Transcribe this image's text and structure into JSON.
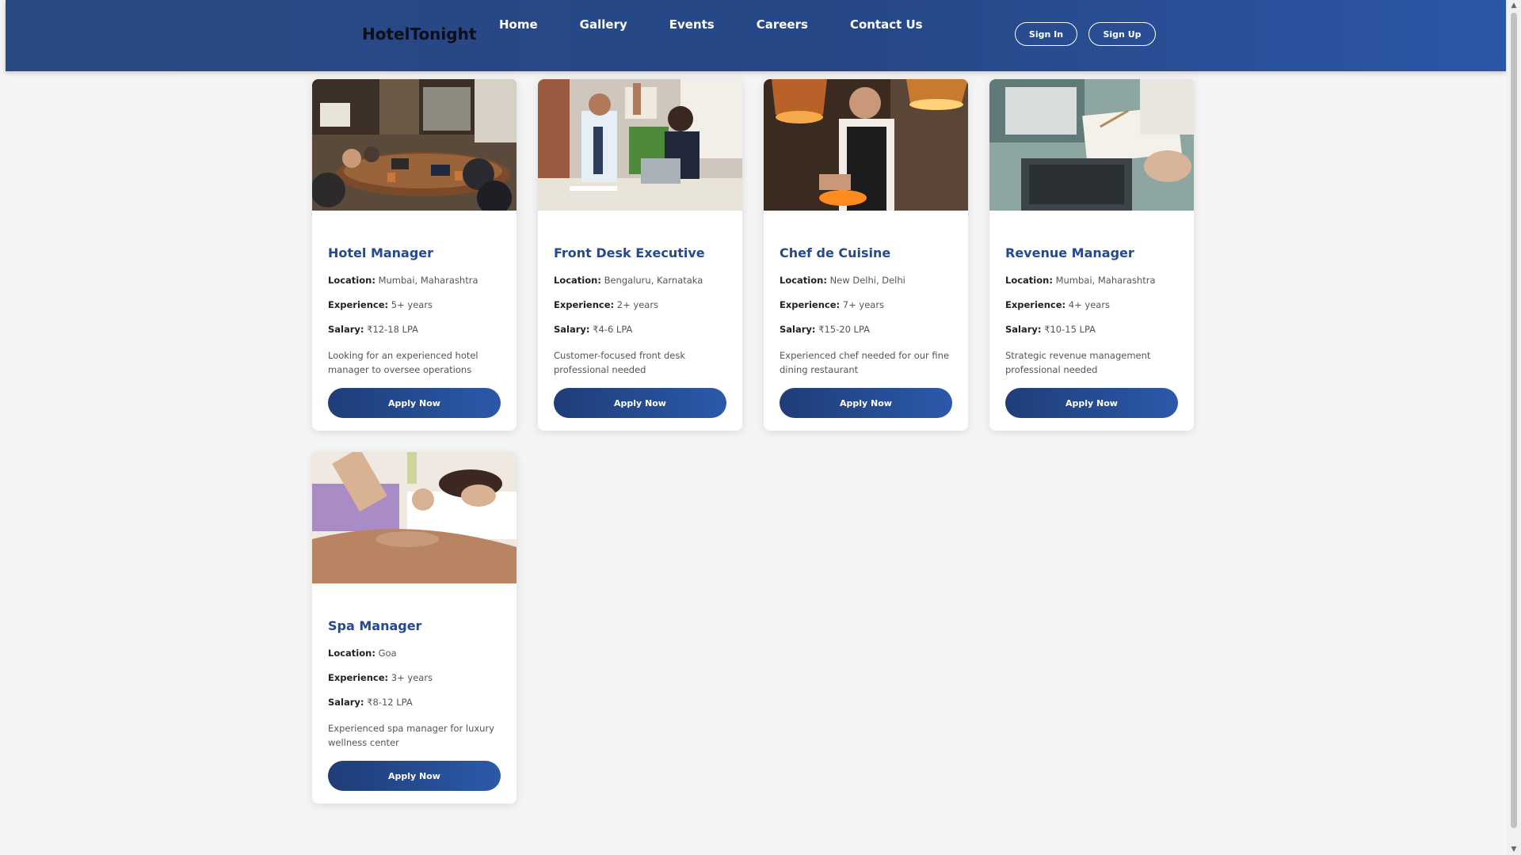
{
  "brand": "HotelTonight",
  "nav": [
    "Home",
    "Gallery",
    "Events",
    "Careers",
    "Contact Us"
  ],
  "auth": {
    "signin": "Sign In",
    "signup": "Sign Up"
  },
  "labels": {
    "location": "Location:",
    "experience": "Experience:",
    "salary": "Salary:"
  },
  "apply_label": "Apply Now",
  "jobs": [
    {
      "title": "Hotel Manager",
      "location": "Mumbai, Maharashtra",
      "experience": "5+ years",
      "salary": "₹12-18 LPA",
      "description": "Looking for an experienced hotel manager to oversee operations",
      "image": "meeting-room-photo"
    },
    {
      "title": "Front Desk Executive",
      "location": "Bengaluru, Karnataka",
      "experience": "2+ years",
      "salary": "₹4-6 LPA",
      "description": "Customer-focused front desk professional needed",
      "image": "office-high-five-photo"
    },
    {
      "title": "Chef de Cuisine",
      "location": "New Delhi, Delhi",
      "experience": "7+ years",
      "salary": "₹15-20 LPA",
      "description": "Experienced chef needed for our fine dining restaurant",
      "image": "chef-plating-photo"
    },
    {
      "title": "Revenue Manager",
      "location": "Mumbai, Maharashtra",
      "experience": "4+ years",
      "salary": "₹10-15 LPA",
      "description": "Strategic revenue management professional needed",
      "image": "laptop-paperwork-photo"
    },
    {
      "title": "Spa Manager",
      "location": "Goa",
      "experience": "3+ years",
      "salary": "₹8-12 LPA",
      "description": "Experienced spa manager for luxury wellness center",
      "image": "spa-massage-photo"
    }
  ]
}
